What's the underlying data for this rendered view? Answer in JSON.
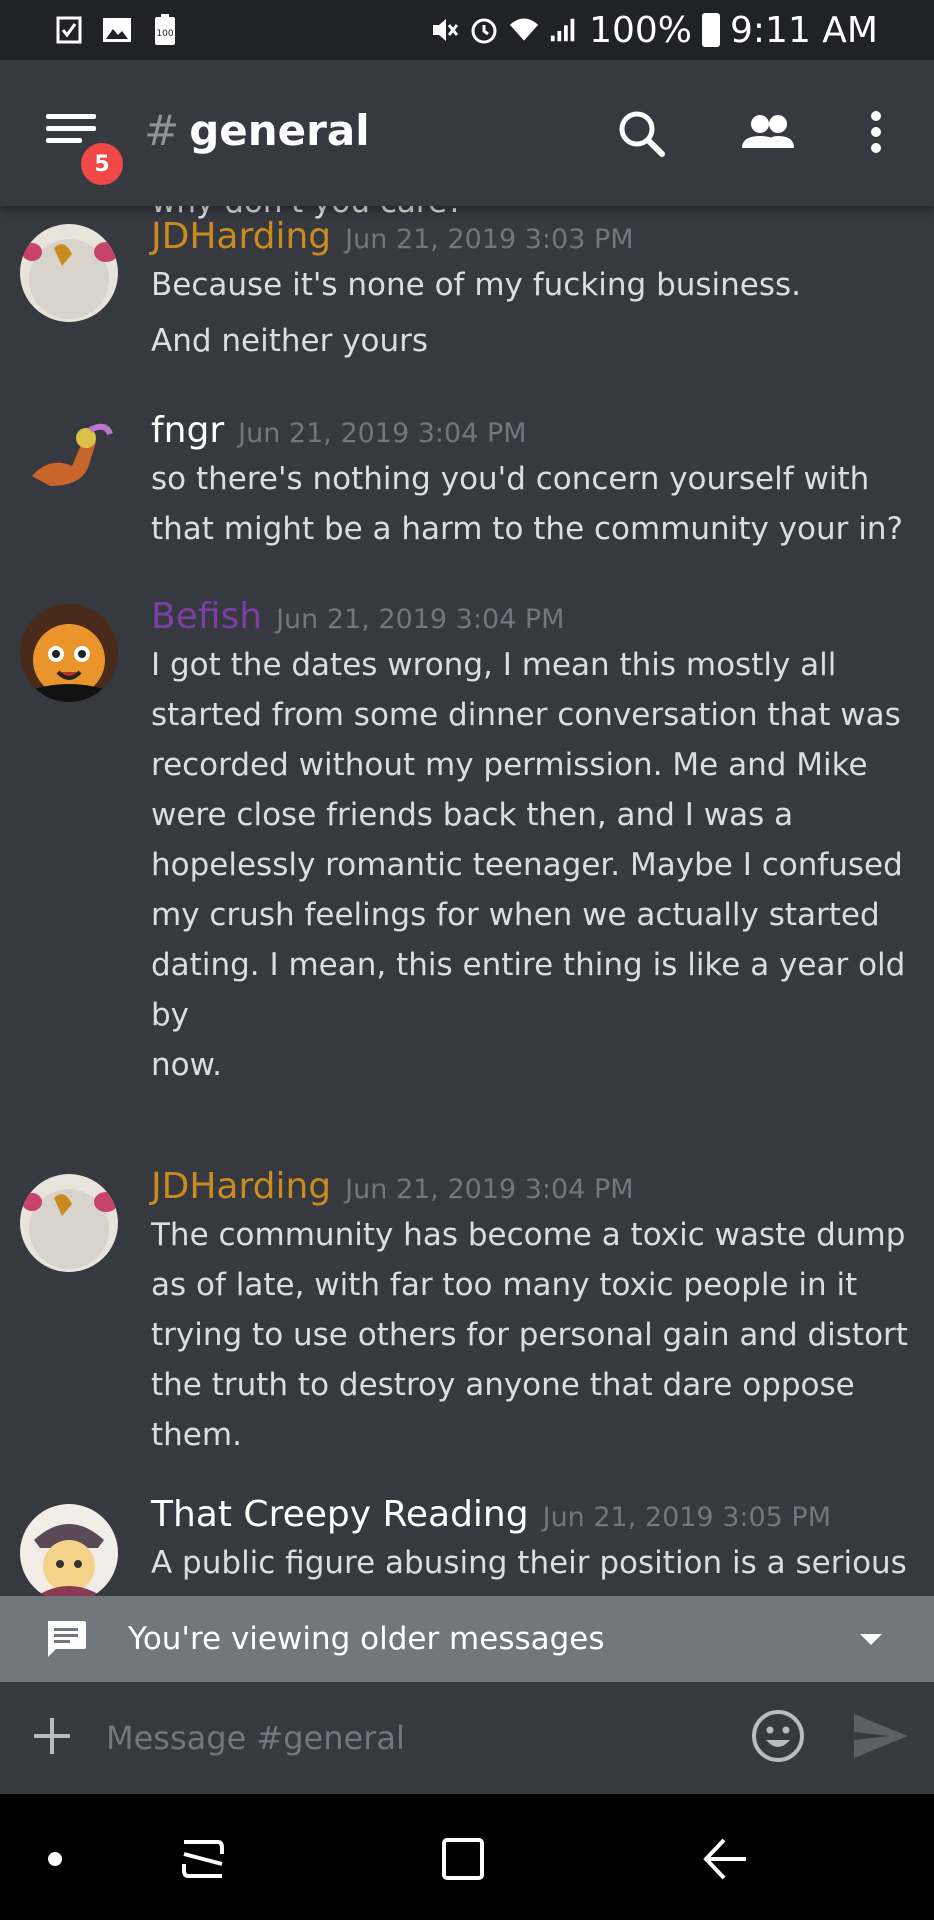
{
  "status_bar": {
    "battery_text": "100%",
    "time": "9:11 AM",
    "left_icons": [
      "checkbox-icon",
      "gallery-icon",
      "battery-100-icon"
    ],
    "right_icons": [
      "mute-icon",
      "alarm-icon",
      "wifi-icon",
      "signal-icon",
      "battery-icon"
    ]
  },
  "header": {
    "hash": "#",
    "channel": "general",
    "badge": "5"
  },
  "messages": {
    "previous_line": "why don't you care?",
    "items": [
      {
        "author": "JDHarding",
        "author_color": "#c98b1f",
        "timestamp": "Jun 21, 2019 3:03 PM",
        "lines": [
          "Because it's none of my fucking business.",
          "And neither yours"
        ]
      },
      {
        "author": "fngr",
        "author_color": "#ffffff",
        "timestamp": "Jun 21, 2019 3:04 PM",
        "lines": [
          "so there's nothing you'd concern yourself with",
          "that might be a harm to the community your in?"
        ]
      },
      {
        "author": "Befish",
        "author_color": "#7d3fa5",
        "timestamp": "Jun 21, 2019 3:04 PM",
        "lines": [
          "I got the dates wrong, I mean this mostly all",
          "started from some dinner conversation that was",
          "recorded without my permission. Me and Mike",
          "were close friends back then, and I was a",
          "hopelessly romantic teenager. Maybe I confused",
          "my crush feelings for when we actually started",
          "dating. I mean, this entire thing is like a year old by",
          "now."
        ]
      },
      {
        "author": "JDHarding",
        "author_color": "#c98b1f",
        "timestamp": "Jun 21, 2019 3:04 PM",
        "lines": [
          "The community has become a toxic waste dump",
          "as of late, with far too many toxic people in it",
          "trying to use others for personal gain and distort",
          "the truth to destroy anyone that dare oppose",
          "them."
        ]
      },
      {
        "author": "That Creepy Reading",
        "author_color": "#ffffff",
        "timestamp": "Jun 21, 2019 3:05 PM",
        "lines": [
          "A public figure abusing their position is a serious"
        ]
      }
    ]
  },
  "older_bar": {
    "text": "You're viewing older messages"
  },
  "composer": {
    "placeholder": "Message #general"
  }
}
